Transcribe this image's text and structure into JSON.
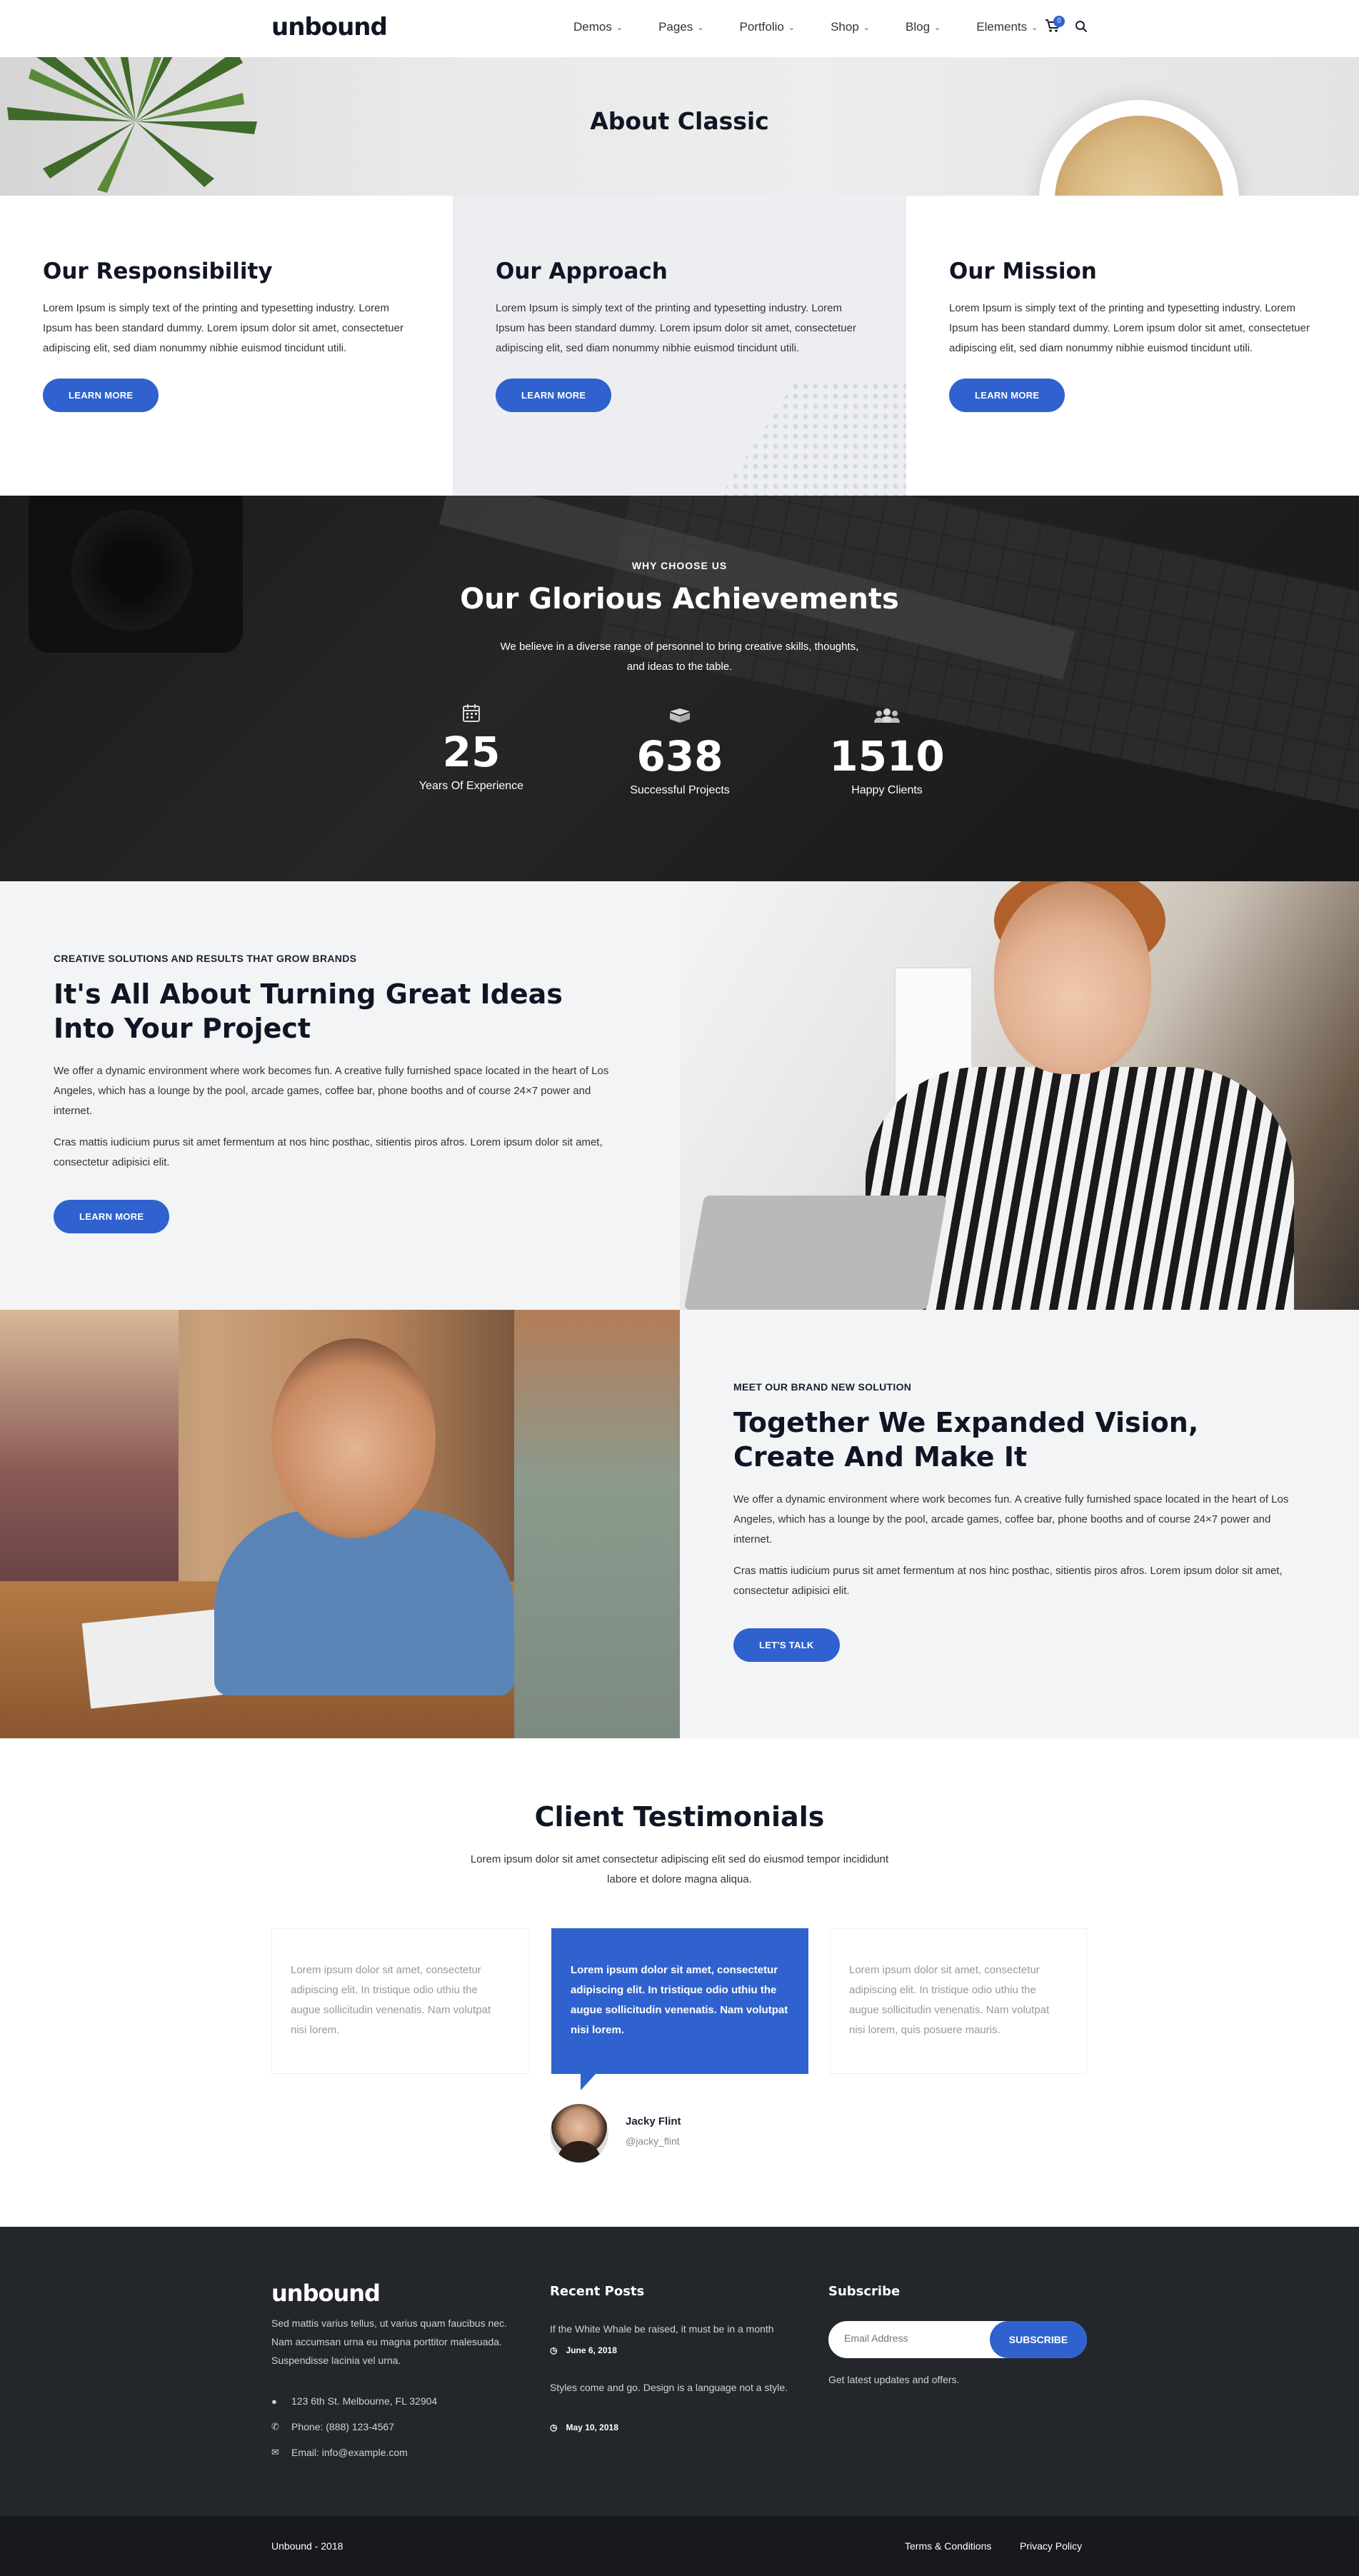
{
  "header": {
    "logo": "unbound",
    "nav": [
      {
        "label": "Demos"
      },
      {
        "label": "Pages"
      },
      {
        "label": "Portfolio"
      },
      {
        "label": "Shop"
      },
      {
        "label": "Blog"
      },
      {
        "label": "Elements"
      }
    ],
    "cart_count": "0"
  },
  "hero": {
    "title": "About Classic"
  },
  "features": [
    {
      "title": "Our Responsibility",
      "text": "Lorem Ipsum is simply text of the printing and typesetting industry. Lorem Ipsum has been standard dummy. Lorem ipsum dolor sit amet, consectetuer adipiscing elit, sed diam nonummy nibhie euismod tincidunt utili.",
      "button": "LEARN MORE"
    },
    {
      "title": "Our Approach",
      "text": "Lorem Ipsum is simply text of the printing and typesetting industry. Lorem Ipsum has been standard dummy. Lorem ipsum dolor sit amet, consectetuer adipiscing elit, sed diam nonummy nibhie euismod tincidunt utili.",
      "button": "LEARN MORE"
    },
    {
      "title": "Our Mission",
      "text": "Lorem Ipsum is simply text of the printing and typesetting industry. Lorem Ipsum has been standard dummy. Lorem ipsum dolor sit amet, consectetuer adipiscing elit, sed diam nonummy nibhie euismod tincidunt utili.",
      "button": "LEARN MORE"
    }
  ],
  "achievements": {
    "kicker": "WHY CHOOSE US",
    "title": "Our Glorious Achievements",
    "desc": "We believe in a diverse range of personnel to bring creative skills, thoughts, and ideas to the table.",
    "stats": [
      {
        "icon": "calendar-icon",
        "value": "25",
        "label": "Years Of Experience"
      },
      {
        "icon": "box-icon",
        "value": "638",
        "label": "Successful Projects"
      },
      {
        "icon": "users-icon",
        "value": "1510",
        "label": "Happy Clients"
      }
    ]
  },
  "section_ideas": {
    "kicker": "CREATIVE SOLUTIONS AND RESULTS THAT GROW BRANDS",
    "title": "It's All About Turning Great Ideas Into Your Project",
    "p1": "We offer a dynamic environment where work becomes fun. A creative fully furnished space located in the heart of Los Angeles, which has a lounge by the pool, arcade games, coffee bar, phone booths and of course 24×7 power and internet.",
    "p2": "Cras mattis iudicium purus sit amet fermentum at nos hinc posthac, sitientis piros afros. Lorem ipsum dolor sit amet, consectetur adipisici elit.",
    "button": "LEARN MORE"
  },
  "section_vision": {
    "kicker": "MEET OUR BRAND NEW SOLUTION",
    "title": "Together We Expanded Vision, Create And Make It",
    "p1": "We offer a dynamic environment where work becomes fun. A creative fully furnished space located in the heart of Los Angeles, which has a lounge by the pool, arcade games, coffee bar, phone booths and of course 24×7 power and internet.",
    "p2": "Cras mattis iudicium purus sit amet fermentum at nos hinc posthac, sitientis piros afros. Lorem ipsum dolor sit amet, consectetur adipisici elit.",
    "button": "LET'S TALK"
  },
  "testimonials": {
    "title": "Client Testimonials",
    "desc": "Lorem ipsum dolor sit amet consectetur adipiscing elit sed do eiusmod tempor incididunt labore et dolore magna aliqua.",
    "cards": [
      {
        "text": "Lorem ipsum dolor sit amet, consectetur adipiscing elit. In tristique odio uthiu the augue sollicitudin venenatis. Nam volutpat nisi lorem."
      },
      {
        "text": "Lorem ipsum dolor sit amet, consectetur adipiscing elit. In tristique odio uthiu the augue sollicitudin venenatis. Nam volutpat nisi lorem."
      },
      {
        "text": "Lorem ipsum dolor sit amet, consectetur adipiscing elit. In tristique odio uthiu the augue sollicitudin venenatis. Nam volutpat nisi lorem, quis posuere mauris."
      }
    ],
    "author_name": "Jacky Flint",
    "author_handle": "@jacky_flint"
  },
  "footer": {
    "logo": "unbound",
    "about": "Sed mattis varius tellus, ut varius quam faucibus nec. Nam accumsan urna eu magna porttitor malesuada. Suspendisse lacinia vel urna.",
    "address": "123 6th St. Melbourne, FL 32904",
    "phone": "Phone: (888) 123-4567",
    "email": "Email: info@example.com",
    "recent_heading": "Recent Posts",
    "posts": [
      {
        "title": "If the White Whale be raised, it must be in a month",
        "date": "June 6, 2018"
      },
      {
        "title": "Styles come and go. Design is a language not a style.",
        "date": "May 10, 2018"
      }
    ],
    "subscribe_heading": "Subscribe",
    "email_placeholder": "Email Address",
    "subscribe_button": "SUBSCRIBE",
    "subscribe_note": "Get latest updates and offers.",
    "copyright": "Unbound - 2018",
    "terms": "Terms & Conditions",
    "privacy": "Privacy Policy"
  },
  "colors": {
    "accent": "#2f62cf",
    "dark": "#23262b",
    "footer_bottom": "#17191c"
  }
}
